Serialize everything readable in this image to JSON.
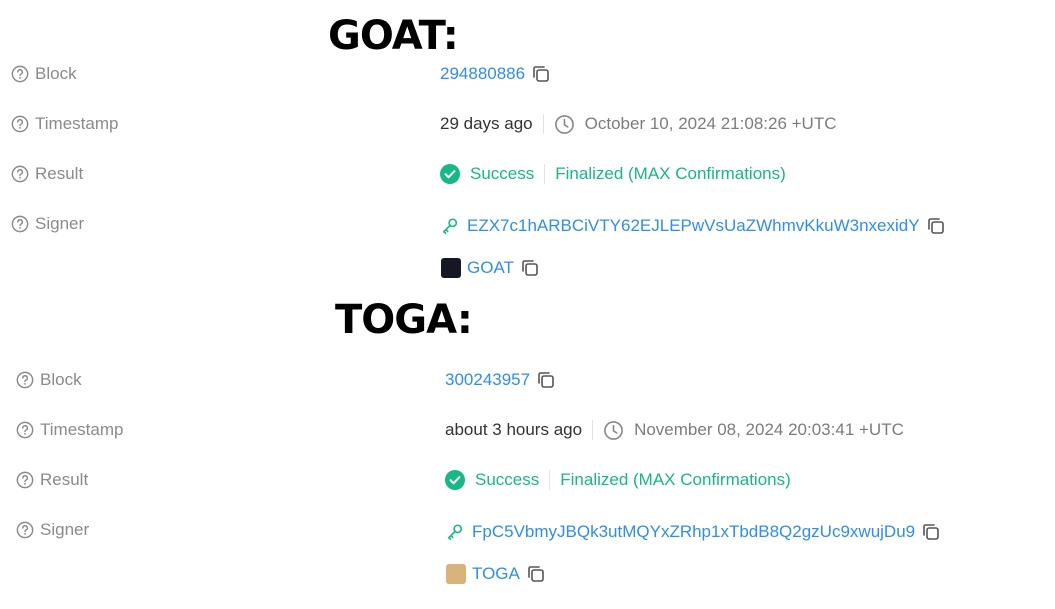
{
  "sections": [
    {
      "heading": "GOAT:",
      "labels": {
        "block": "Block",
        "timestamp": "Timestamp",
        "result": "Result",
        "signer": "Signer"
      },
      "block": "294880886",
      "relative_time": "29 days ago",
      "absolute_time": "October 10, 2024 21:08:26 +UTC",
      "status": "Success",
      "confirmation": "Finalized (MAX Confirmations)",
      "signer_address": "EZX7c1hARBCiVTY62EJLEPwVsUaZWhmvKkuW3nxexidY",
      "token": "GOAT",
      "token_avatar_color": "#141824"
    },
    {
      "heading": "TOGA:",
      "labels": {
        "block": "Block",
        "timestamp": "Timestamp",
        "result": "Result",
        "signer": "Signer"
      },
      "block": "300243957",
      "relative_time": "about 3 hours ago",
      "absolute_time": "November 08, 2024 20:03:41 +UTC",
      "status": "Success",
      "confirmation": "Finalized (MAX Confirmations)",
      "signer_address": "FpC5VbmyJBQk3utMQYxZRhp1xTbdB8Q2gzUc9xwujDu9",
      "token": "TOGA",
      "token_avatar_color": "#d9b37a"
    }
  ],
  "colors": {
    "link": "#2f8ee8",
    "success": "#17b787",
    "label": "#8a8a8a"
  }
}
